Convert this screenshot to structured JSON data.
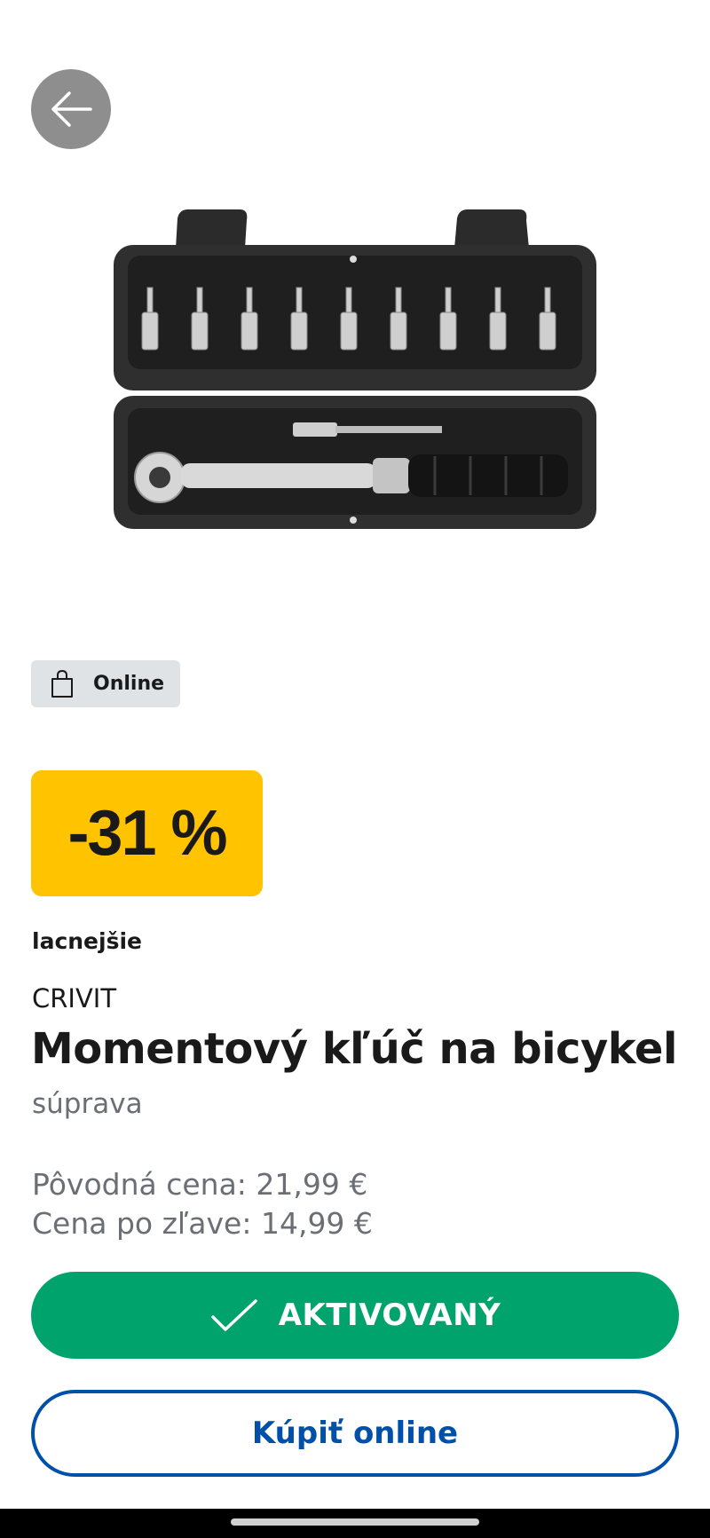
{
  "header": {
    "back_icon": "arrow-left-icon"
  },
  "product": {
    "image_icon": "torque-wrench-set-image",
    "availability_badge": "Online",
    "availability_icon": "shopping-bag-icon",
    "discount": "-31 %",
    "discount_caption": "lacnejšie",
    "brand": "CRIVIT",
    "title": "Momentový kľúč na bicykel",
    "subtitle": "súprava",
    "price_original": "Pôvodná cena: 21,99 €",
    "price_sale": "Cena po zľave: 14,99 €"
  },
  "actions": {
    "activated_label": "AKTIVOVANÝ",
    "activated_icon": "checkmark-icon",
    "buy_label": "Kúpiť online"
  },
  "colors": {
    "discount_bg": "#ffc300",
    "activated_bg": "#00a36c",
    "buy_border": "#0050aa",
    "badge_bg": "#e0e3e6"
  }
}
